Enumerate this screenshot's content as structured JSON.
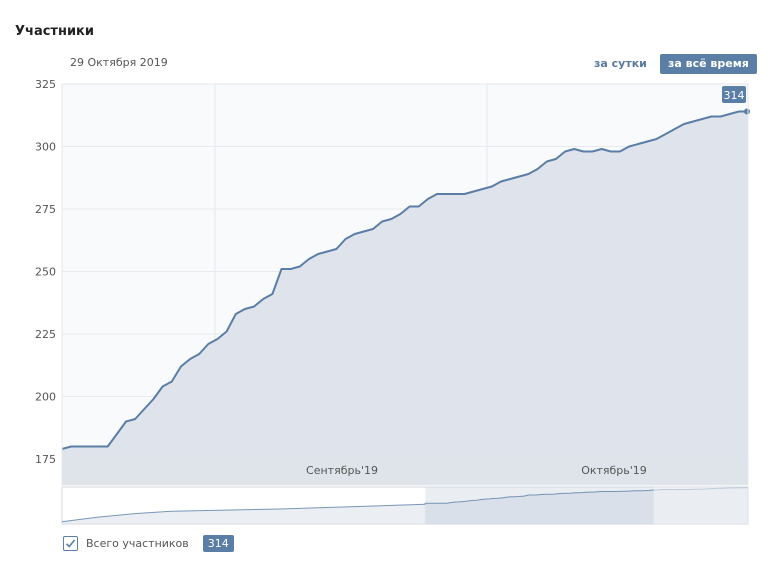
{
  "header": {
    "title": "Участники",
    "date": "29 Октября 2019",
    "period_day": "за сутки",
    "period_all": "за всё время"
  },
  "legend": {
    "label": "Всего участников",
    "value": "314",
    "checked": true
  },
  "colors": {
    "line": "#5b7ea6",
    "fill": "#dde3eb",
    "accent": "#5b7ea6"
  },
  "chart_data": {
    "type": "area",
    "title": "",
    "xlabel": "",
    "ylabel": "",
    "ylim": [
      170,
      325
    ],
    "yticks": [
      175,
      200,
      225,
      250,
      275,
      300,
      325
    ],
    "month_labels": [
      {
        "label": "Сентябрь'19",
        "x": 37
      },
      {
        "label": "Октябрь'19",
        "x": 67
      }
    ],
    "last_value_label": "314",
    "x": [
      0,
      1,
      2,
      3,
      4,
      5,
      6,
      7,
      8,
      9,
      10,
      11,
      12,
      13,
      14,
      15,
      16,
      17,
      18,
      19,
      20,
      21,
      22,
      23,
      24,
      25,
      26,
      27,
      28,
      29,
      30,
      31,
      32,
      33,
      34,
      35,
      36,
      37,
      38,
      39,
      40,
      41,
      42,
      43,
      44,
      45,
      46,
      47,
      48,
      49,
      50,
      51,
      52,
      53,
      54,
      55,
      56,
      57,
      58,
      59,
      60,
      61,
      62,
      63,
      64,
      65,
      66,
      67,
      68,
      69,
      70,
      71,
      72,
      73,
      74,
      75
    ],
    "series": [
      {
        "values": [
          179,
          180,
          180,
          180,
          180,
          180,
          185,
          190,
          191,
          195,
          199,
          204,
          206,
          212,
          215,
          217,
          221,
          223,
          226,
          233,
          235,
          236,
          239,
          241,
          251,
          251,
          252,
          255,
          257,
          258,
          259,
          263,
          265,
          266,
          267,
          270,
          271,
          273,
          276,
          276,
          279,
          281,
          281,
          281,
          281,
          282,
          283,
          284,
          286,
          287,
          288,
          289,
          291,
          294,
          295,
          298,
          299,
          298,
          298,
          299,
          298,
          298,
          300,
          301,
          302,
          303,
          305,
          307,
          309,
          310,
          311,
          312,
          312,
          313,
          314,
          314
        ]
      }
    ]
  }
}
